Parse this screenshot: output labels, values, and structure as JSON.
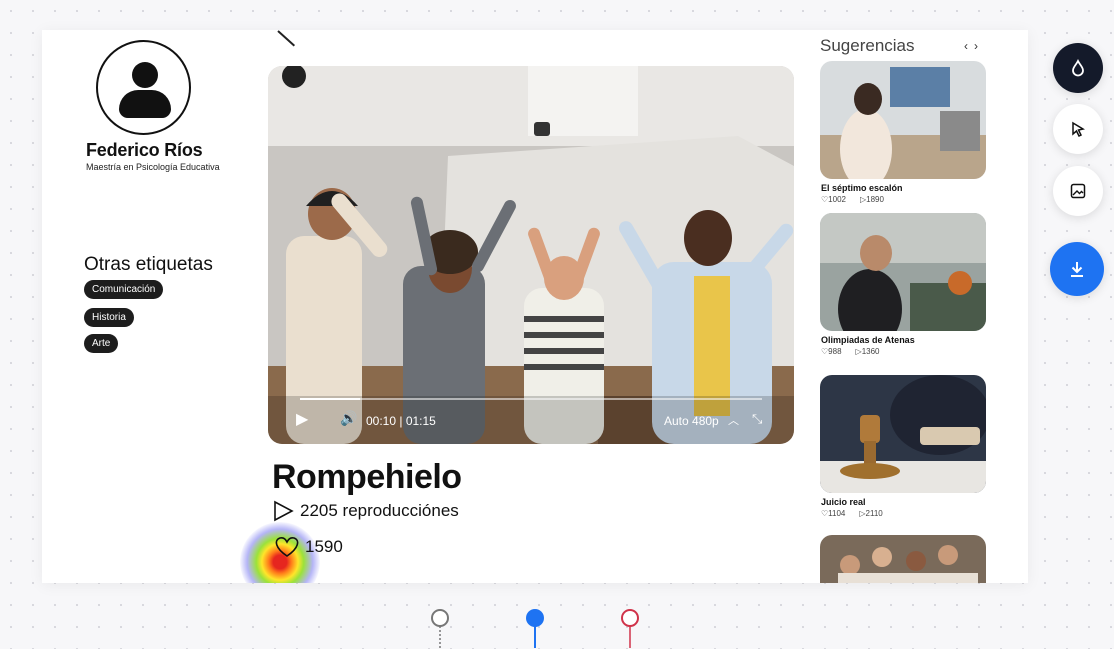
{
  "profile": {
    "name": "Federico Ríos",
    "subtitle": "Maestría en Psicología Educativa"
  },
  "tags": {
    "title": "Otras etiquetas",
    "items": [
      "Comunicación",
      "Historia",
      "Arte"
    ]
  },
  "video": {
    "time": "00:10 | 01:15",
    "quality": "Auto 480p",
    "progress": 0.13,
    "title": "Rompehielo",
    "views": "2205 reproducciónes",
    "likes": "1590"
  },
  "suggestions": {
    "title": "Sugerencias",
    "prev": "‹",
    "next": "›",
    "items": [
      {
        "title": "El séptimo escalón",
        "likes": "1002",
        "plays": "1890"
      },
      {
        "title": "Olimpiadas de Atenas",
        "likes": "988",
        "plays": "1360"
      },
      {
        "title": "Juicio real",
        "likes": "1104",
        "plays": "2110"
      }
    ]
  },
  "toolbar": {
    "tools": [
      "drop-icon",
      "cursor-icon",
      "image-icon",
      "download-icon"
    ],
    "accent": "#1e73f2",
    "dark": "#141a2a"
  },
  "pins": {
    "colors": [
      "#777777",
      "#1e73f2",
      "#d0334a"
    ]
  }
}
